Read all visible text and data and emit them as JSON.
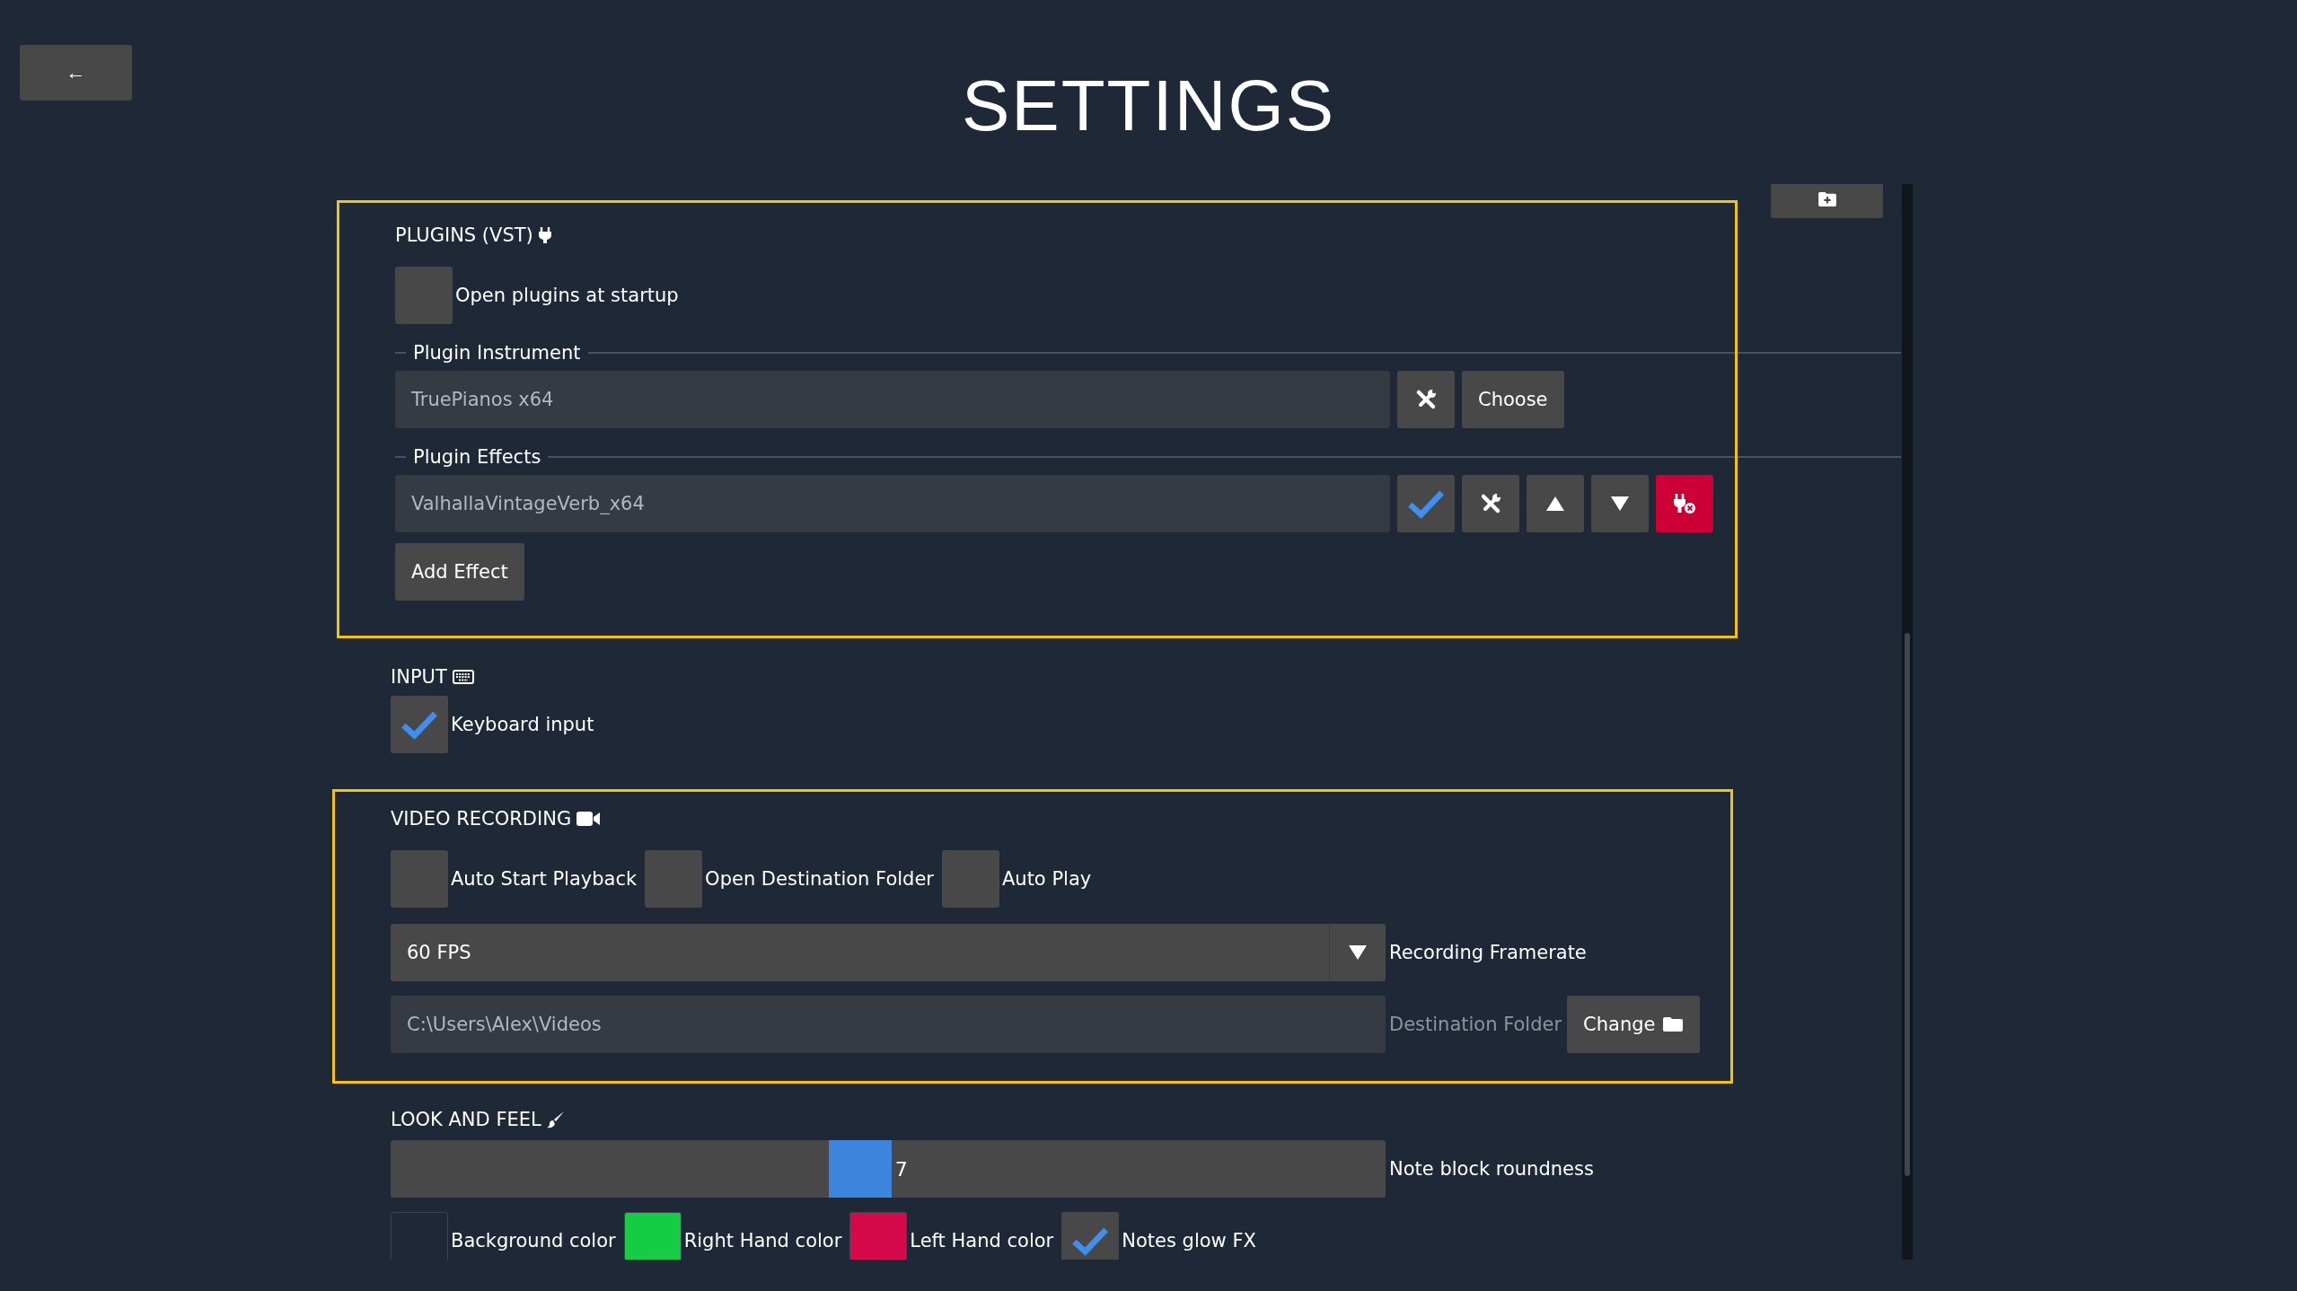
{
  "back_button": "←",
  "title": "SETTINGS",
  "plugins": {
    "heading": "PLUGINS (VST)",
    "highlighted": true,
    "open_at_startup": {
      "label": "Open plugins at startup",
      "checked": false
    },
    "instrument": {
      "legend": "Plugin Instrument",
      "value": "TruePianos x64",
      "choose": "Choose"
    },
    "effects": {
      "legend": "Plugin Effects",
      "items": [
        {
          "name": "ValhallaVintageVerb_x64",
          "enabled": true
        }
      ],
      "add": "Add Effect"
    }
  },
  "input": {
    "heading": "INPUT",
    "options": [
      {
        "label": "Keyboard input",
        "checked": true
      }
    ]
  },
  "video": {
    "heading": "VIDEO RECORDING",
    "highlighted": true,
    "options": [
      {
        "label": "Auto Start Playback",
        "checked": false
      },
      {
        "label": "Open Destination Folder",
        "checked": false
      },
      {
        "label": "Auto Play",
        "checked": false
      }
    ],
    "framerate": {
      "value": "60 FPS",
      "label": "Recording Framerate"
    },
    "destination": {
      "value": "C:\\Users\\Alex\\Videos",
      "label": "Destination Folder",
      "button": "Change"
    }
  },
  "look": {
    "heading": "LOOK AND FEEL",
    "roundness": {
      "level": 0.47,
      "reading": "7",
      "label": "Note block roundness"
    },
    "colors": [
      {
        "label": "Background color",
        "color": "#1f2837"
      },
      {
        "label": "Right Hand color",
        "color": "#17cc45"
      },
      {
        "label": "Left Hand color",
        "color": "#d40a4a"
      }
    ],
    "glow": {
      "label": "Notes glow FX",
      "checked": true
    }
  }
}
